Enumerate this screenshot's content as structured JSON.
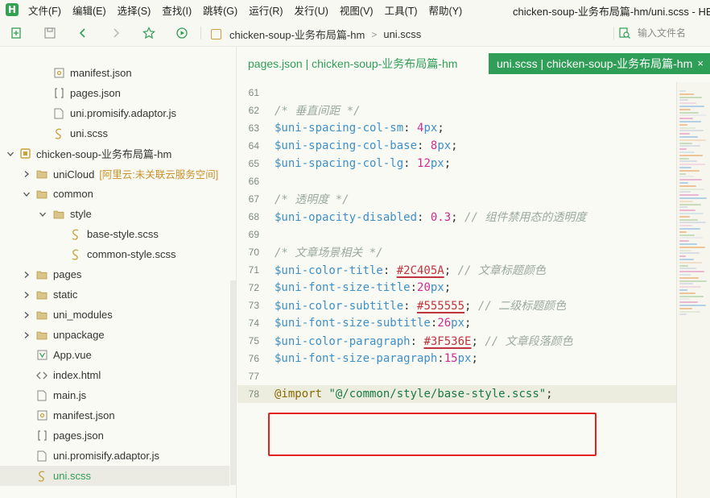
{
  "app": {
    "logo_letter": "H",
    "window_title": "chicken-soup-业务布局篇-hm/uni.scss - HBuilder X"
  },
  "menu": [
    "文件(F)",
    "编辑(E)",
    "选择(S)",
    "查找(I)",
    "跳转(G)",
    "运行(R)",
    "发行(U)",
    "视图(V)",
    "工具(T)",
    "帮助(Y)"
  ],
  "toolbar": {
    "breadcrumb": [
      "chicken-soup-业务布局篇-hm",
      "uni.scss"
    ],
    "search_placeholder": "输入文件名"
  },
  "sidebar": {
    "items": [
      {
        "label": "manifest.json",
        "icon": "json-config-icon",
        "depth": 2,
        "caret": ""
      },
      {
        "label": "pages.json",
        "icon": "brackets-icon",
        "depth": 2,
        "caret": ""
      },
      {
        "label": "uni.promisify.adaptor.js",
        "icon": "file-icon",
        "depth": 2,
        "caret": ""
      },
      {
        "label": "uni.scss",
        "icon": "scss-icon",
        "depth": 2,
        "caret": ""
      },
      {
        "label": "chicken-soup-业务布局篇-hm",
        "icon": "project-icon",
        "depth": 0,
        "caret": "down"
      },
      {
        "label": "uniCloud",
        "extra": "[阿里云:未关联云服务空间]",
        "icon": "folder-icon",
        "depth": 1,
        "caret": "right"
      },
      {
        "label": "common",
        "icon": "folder-icon",
        "depth": 1,
        "caret": "down"
      },
      {
        "label": "style",
        "icon": "folder-icon",
        "depth": 2,
        "caret": "down"
      },
      {
        "label": "base-style.scss",
        "icon": "scss-icon",
        "depth": 3,
        "caret": ""
      },
      {
        "label": "common-style.scss",
        "icon": "scss-icon",
        "depth": 3,
        "caret": ""
      },
      {
        "label": "pages",
        "icon": "folder-icon",
        "depth": 1,
        "caret": "right"
      },
      {
        "label": "static",
        "icon": "folder-icon",
        "depth": 1,
        "caret": "right"
      },
      {
        "label": "uni_modules",
        "icon": "folder-icon",
        "depth": 1,
        "caret": "right"
      },
      {
        "label": "unpackage",
        "icon": "folder-icon",
        "depth": 1,
        "caret": "right"
      },
      {
        "label": "App.vue",
        "icon": "vue-icon",
        "depth": 1,
        "caret": ""
      },
      {
        "label": "index.html",
        "icon": "html-icon",
        "depth": 1,
        "caret": ""
      },
      {
        "label": "main.js",
        "icon": "file-icon",
        "depth": 1,
        "caret": ""
      },
      {
        "label": "manifest.json",
        "icon": "json-config-icon",
        "depth": 1,
        "caret": ""
      },
      {
        "label": "pages.json",
        "icon": "brackets-icon",
        "depth": 1,
        "caret": ""
      },
      {
        "label": "uni.promisify.adaptor.js",
        "icon": "file-icon",
        "depth": 1,
        "caret": ""
      },
      {
        "label": "uni.scss",
        "icon": "scss-icon",
        "depth": 1,
        "caret": "",
        "selected": true
      }
    ]
  },
  "tabs": [
    {
      "label": "pages.json | chicken-soup-业务布局篇-hm",
      "active": false
    },
    {
      "label": "uni.scss | chicken-soup-业务布局篇-hm",
      "active": true
    }
  ],
  "tab_close_glyph": "×",
  "code": {
    "current_line": 78,
    "lines": [
      {
        "n": "61",
        "tokens": []
      },
      {
        "n": "62",
        "tokens": [
          {
            "t": "/* 垂直间距 */",
            "c": "comment"
          }
        ]
      },
      {
        "n": "63",
        "tokens": [
          {
            "t": "$uni-spacing-col-sm",
            "c": "var"
          },
          {
            "t": ": ",
            "c": "punc"
          },
          {
            "t": "4",
            "c": "num"
          },
          {
            "t": "px",
            "c": "unit"
          },
          {
            "t": ";",
            "c": "punc"
          }
        ]
      },
      {
        "n": "64",
        "tokens": [
          {
            "t": "$uni-spacing-col-base",
            "c": "var"
          },
          {
            "t": ": ",
            "c": "punc"
          },
          {
            "t": "8",
            "c": "num"
          },
          {
            "t": "px",
            "c": "unit"
          },
          {
            "t": ";",
            "c": "punc"
          }
        ]
      },
      {
        "n": "65",
        "tokens": [
          {
            "t": "$uni-spacing-col-lg",
            "c": "var"
          },
          {
            "t": ": ",
            "c": "punc"
          },
          {
            "t": "12",
            "c": "num"
          },
          {
            "t": "px",
            "c": "unit"
          },
          {
            "t": ";",
            "c": "punc"
          }
        ]
      },
      {
        "n": "66",
        "tokens": []
      },
      {
        "n": "67",
        "tokens": [
          {
            "t": "/* 透明度 */",
            "c": "comment"
          }
        ]
      },
      {
        "n": "68",
        "tokens": [
          {
            "t": "$uni-opacity-disabled",
            "c": "var"
          },
          {
            "t": ": ",
            "c": "punc"
          },
          {
            "t": "0.3",
            "c": "num"
          },
          {
            "t": "; ",
            "c": "punc"
          },
          {
            "t": "// 组件禁用态的透明度",
            "c": "comment"
          }
        ]
      },
      {
        "n": "69",
        "tokens": []
      },
      {
        "n": "70",
        "tokens": [
          {
            "t": "/* 文章场景相关 */",
            "c": "comment"
          }
        ]
      },
      {
        "n": "71",
        "tokens": [
          {
            "t": "$uni-color-title",
            "c": "var"
          },
          {
            "t": ": ",
            "c": "punc"
          },
          {
            "t": "#2C405A",
            "c": "color"
          },
          {
            "t": "; ",
            "c": "punc"
          },
          {
            "t": "// 文章标题颜色",
            "c": "comment"
          }
        ]
      },
      {
        "n": "72",
        "tokens": [
          {
            "t": "$uni-font-size-title",
            "c": "var"
          },
          {
            "t": ":",
            "c": "punc"
          },
          {
            "t": "20",
            "c": "num"
          },
          {
            "t": "px",
            "c": "unit"
          },
          {
            "t": ";",
            "c": "punc"
          }
        ]
      },
      {
        "n": "73",
        "tokens": [
          {
            "t": "$uni-color-subtitle",
            "c": "var"
          },
          {
            "t": ": ",
            "c": "punc"
          },
          {
            "t": "#555555",
            "c": "color"
          },
          {
            "t": "; ",
            "c": "punc"
          },
          {
            "t": "// 二级标题颜色",
            "c": "comment"
          }
        ]
      },
      {
        "n": "74",
        "tokens": [
          {
            "t": "$uni-font-size-subtitle",
            "c": "var"
          },
          {
            "t": ":",
            "c": "punc"
          },
          {
            "t": "26",
            "c": "num"
          },
          {
            "t": "px",
            "c": "unit"
          },
          {
            "t": ";",
            "c": "punc"
          }
        ]
      },
      {
        "n": "75",
        "tokens": [
          {
            "t": "$uni-color-paragraph",
            "c": "var"
          },
          {
            "t": ": ",
            "c": "punc"
          },
          {
            "t": "#3F536E",
            "c": "color"
          },
          {
            "t": "; ",
            "c": "punc"
          },
          {
            "t": "// 文章段落颜色",
            "c": "comment"
          }
        ]
      },
      {
        "n": "76",
        "tokens": [
          {
            "t": "$uni-font-size-paragraph",
            "c": "var"
          },
          {
            "t": ":",
            "c": "punc"
          },
          {
            "t": "15",
            "c": "num"
          },
          {
            "t": "px",
            "c": "unit"
          },
          {
            "t": ";",
            "c": "punc"
          }
        ]
      },
      {
        "n": "77",
        "tokens": []
      },
      {
        "n": "78",
        "tokens": [
          {
            "t": "@import",
            "c": "at"
          },
          {
            "t": " ",
            "c": "punc"
          },
          {
            "t": "\"@/common/style/base-style.scss\"",
            "c": "str"
          },
          {
            "t": ";",
            "c": "punc"
          }
        ]
      }
    ]
  },
  "colors": {
    "accent": "#2f9e56",
    "highlight_box": "#e5211f"
  }
}
